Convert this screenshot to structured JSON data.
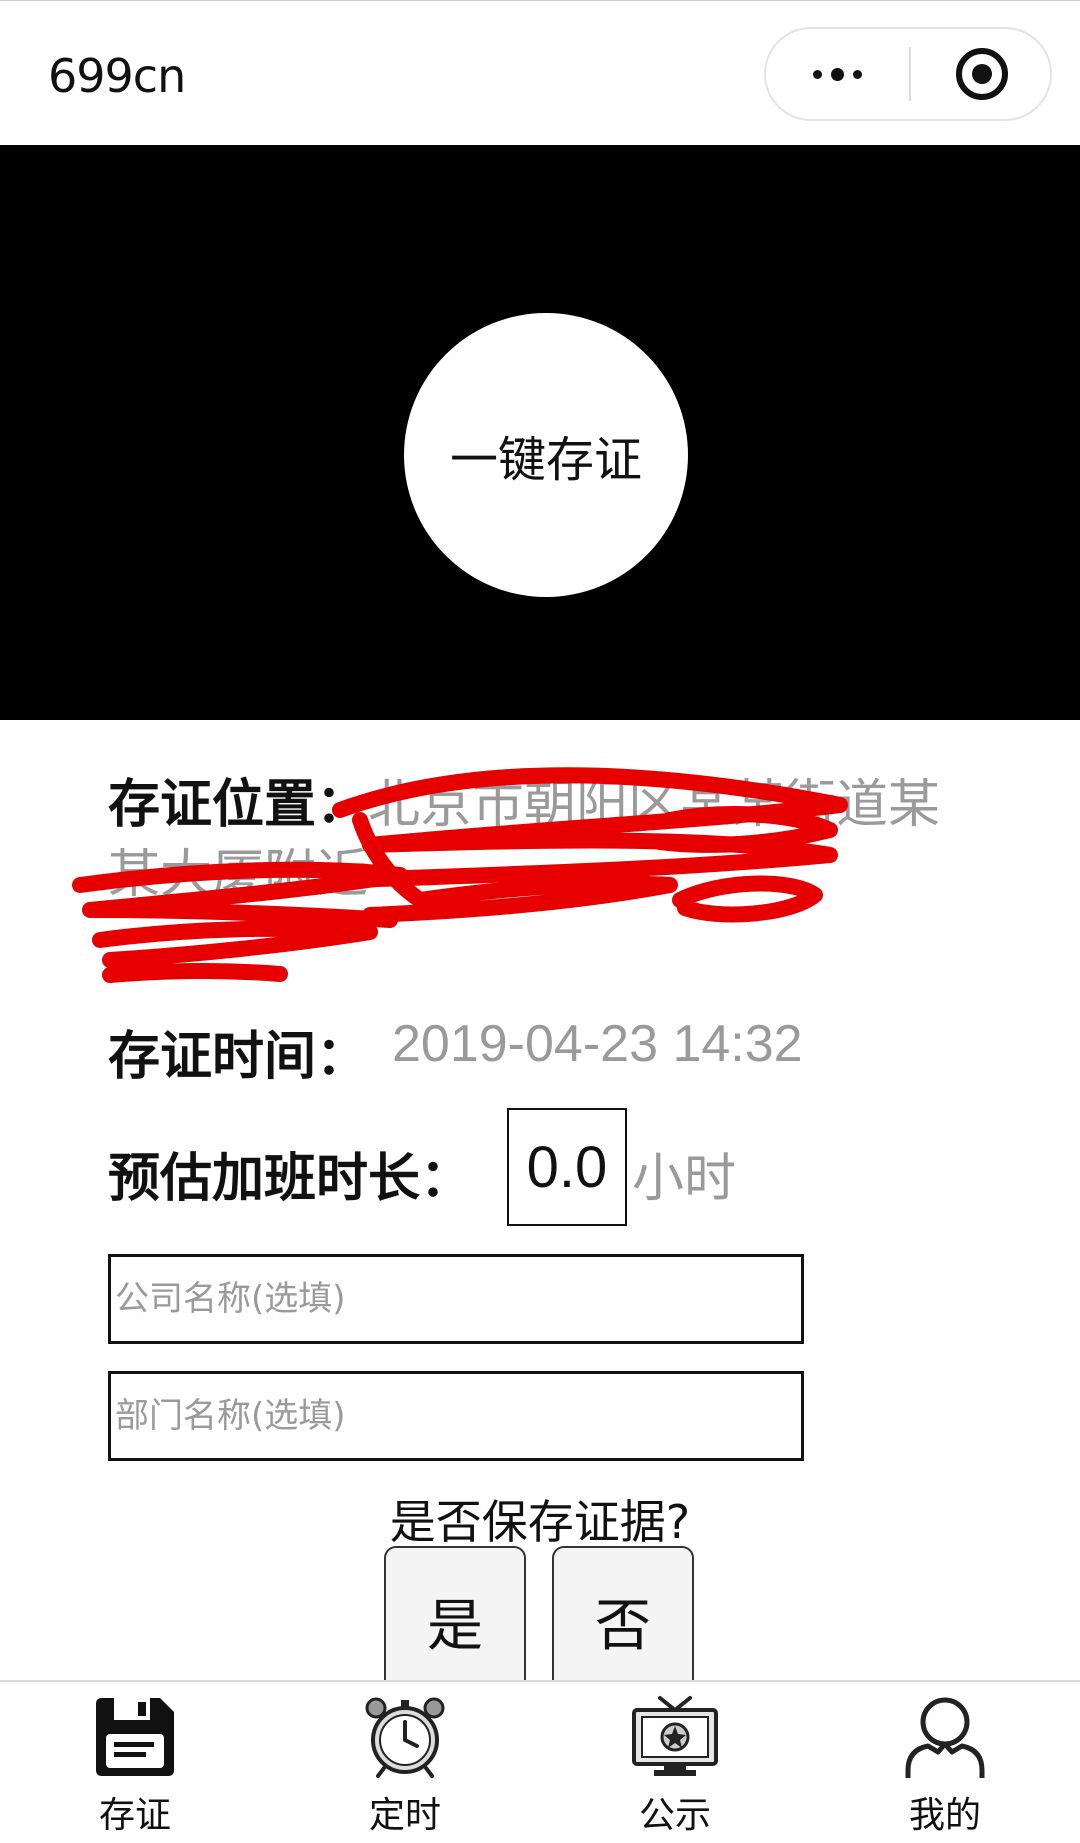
{
  "navbar": {
    "title": "699cn",
    "more_icon": "more-dots-icon",
    "close_icon": "target-circle-icon"
  },
  "banner": {
    "one_key_label": "一键存证",
    "background_color": "#000000"
  },
  "form": {
    "location_label": "存证位置：",
    "location_value": "北京市朝阳区某某街道某某大厦附近",
    "location_redacted": true,
    "time_label": "存证时间：",
    "time_value": "2019-04-23 14:32",
    "overtime_label": "预估加班时长：",
    "overtime_value": "0.0",
    "overtime_unit": "小时",
    "company_placeholder": "公司名称(选填)",
    "department_placeholder": "部门名称(选填)"
  },
  "confirm": {
    "question": "是否保存证据?",
    "yes_label": "是",
    "no_label": "否"
  },
  "tabbar": {
    "items": [
      {
        "label": "存证",
        "icon": "floppy-disk-icon",
        "active": true
      },
      {
        "label": "定时",
        "icon": "alarm-clock-icon",
        "active": false
      },
      {
        "label": "公示",
        "icon": "tv-icon",
        "active": false
      },
      {
        "label": "我的",
        "icon": "user-icon",
        "active": false
      }
    ]
  },
  "colors": {
    "label_text": "#111111",
    "value_gray": "#9a9a9a",
    "redaction": "#e60000"
  }
}
